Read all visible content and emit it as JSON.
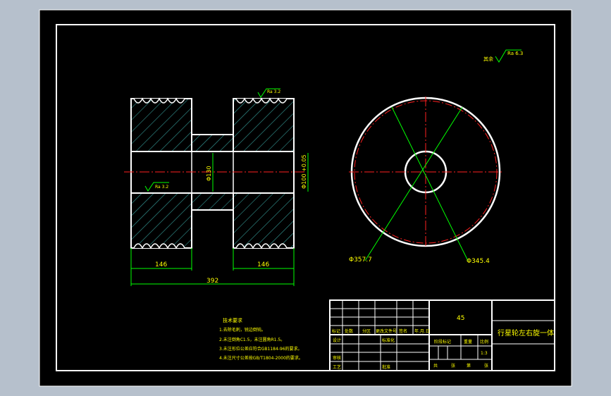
{
  "colors": {
    "paper": "#000000",
    "frame": "#ffffff",
    "dimension": "#00ff00",
    "hatch": "#3fb8b4",
    "centerline": "#ff2020",
    "annotation_text": "#ffff00",
    "outer_bg": "#b6c0cc"
  },
  "roughness": {
    "global": {
      "prefix": "其余",
      "value": "Ra 6.3"
    },
    "top_face": "Ra 3.2",
    "bore": "Ra 3.2"
  },
  "section_view": {
    "dims": {
      "left_width": "146",
      "right_width": "146",
      "total_width": "392",
      "bore_dia": "Φ130",
      "outer_dia_tol": "Φ100 +0.05"
    }
  },
  "end_view": {
    "dims": {
      "outer_dia": "Φ357.7",
      "inner_dia": "Φ345.4"
    }
  },
  "tech_requirements": {
    "title": "技术要求",
    "items": [
      "1.去除毛刺，锐边倒钝。",
      "2.未注倒角C1.5，未注圆角R1.5。",
      "3.未注形位公差应符合GB1184-96的要求。",
      "4.未注尺寸公差按GB/T1804-2000的要求。"
    ]
  },
  "title_block": {
    "material": "45",
    "drawing_name": "行星轮左右旋一体",
    "labels": {
      "mark": "标记",
      "count": "处数",
      "zone": "分区",
      "change_doc": "更改文件号",
      "signature": "签名",
      "date": "年.月.日",
      "design": "设计",
      "standardize": "标准化",
      "review": "审核",
      "process": "工艺",
      "approve": "批准",
      "stage_mark": "阶段标记",
      "weight": "重量",
      "scale": "比例",
      "scale_value": "1:3",
      "sheet_total": "共",
      "sheets": "张",
      "sheet_no": "第",
      "sheet": "张"
    }
  }
}
